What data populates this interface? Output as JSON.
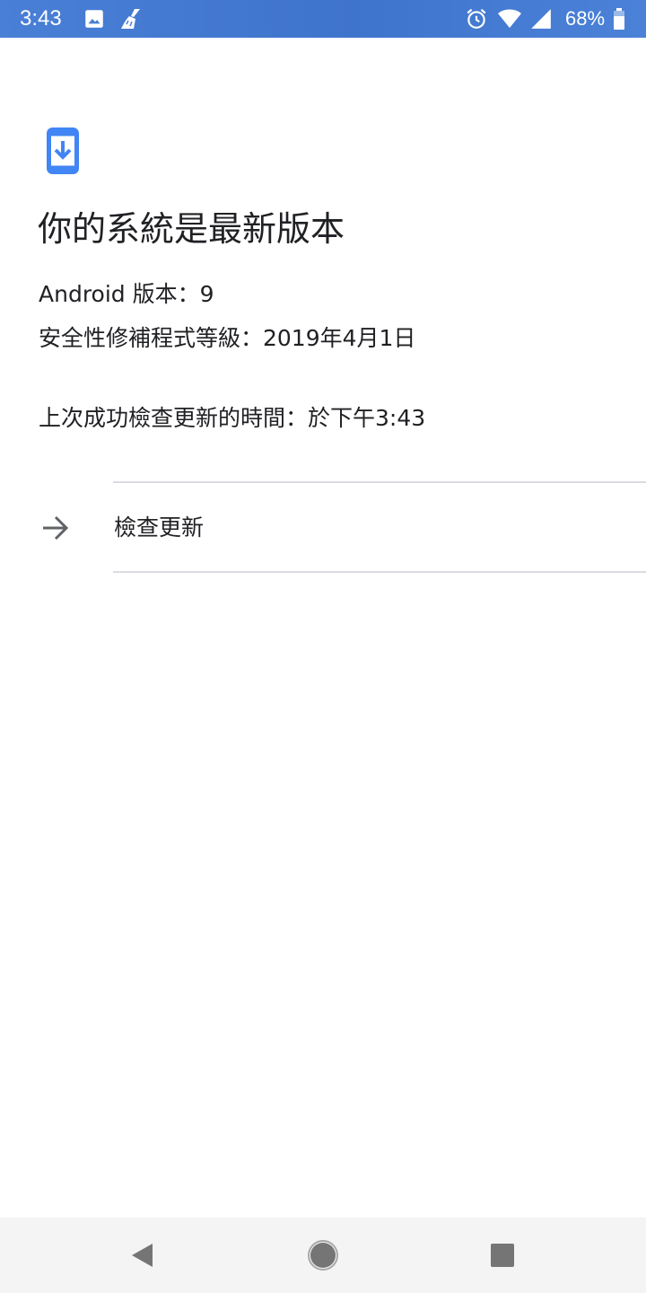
{
  "status_bar": {
    "time": "3:43",
    "battery_percent": "68%",
    "icons": [
      "image-icon",
      "cleaner-broom-icon",
      "alarm-icon",
      "wifi-icon",
      "cell-signal-icon",
      "battery-icon"
    ]
  },
  "main": {
    "icon": "system-update-icon",
    "title": "你的系統是最新版本",
    "android_version": "Android 版本：9",
    "security_patch": "安全性修補程式等級：2019年4月1日",
    "last_check": "上次成功檢查更新的時間：於下午3:43",
    "check_update": {
      "icon": "arrow-right-icon",
      "label": "檢查更新"
    }
  },
  "nav_bar": {
    "buttons": [
      "back-icon",
      "home-icon",
      "recents-icon"
    ]
  },
  "colors": {
    "status_bar": "#4a7fd6",
    "accent_blue": "#4285f4",
    "text_primary": "#202124",
    "divider": "#dadce0",
    "nav_bg": "#f4f4f4",
    "nav_icon": "#757575"
  }
}
